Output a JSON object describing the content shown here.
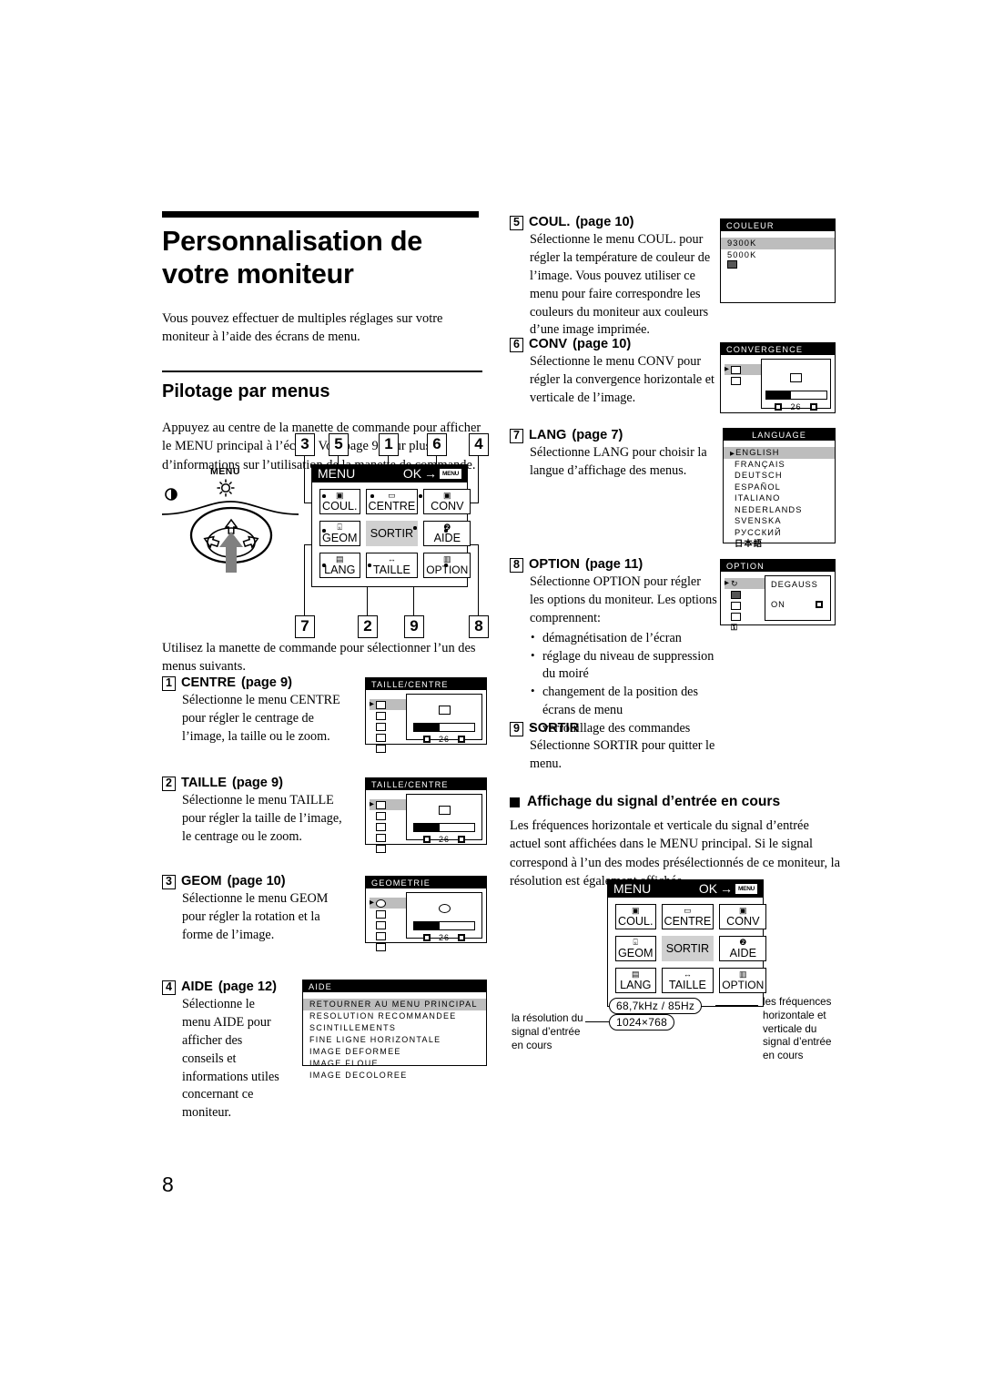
{
  "page": {
    "number": "8"
  },
  "heading": {
    "title": "Personnalisation de votre moniteur",
    "intro": "Vous pouvez effectuer de multiples réglages sur votre moniteur à l’aide des écrans de menu.",
    "subtitle": "Pilotage par menus",
    "body": "Appuyez au centre de la manette de commande pour afficher le MENU principal à l’écran. Voir page 9 pour plus d’informations sur l’utilisation de la manette de commande.",
    "after_diagram": "Utilisez la manette de commande pour sélectionner l’un des menus suivants."
  },
  "joystick": {
    "menu_label": "MENU",
    "brightness_icon": "sun-icon",
    "contrast_icon": "contrast-icon"
  },
  "main_menu": {
    "title": "MENU",
    "ok_label": "OK",
    "ok_arrow": "→",
    "ok_chip": "MENU",
    "cells": [
      {
        "label": "COUL.",
        "glyph": "color-icon"
      },
      {
        "label": "CENTRE",
        "glyph": "centre-icon"
      },
      {
        "label": "CONV",
        "glyph": "conv-icon"
      },
      {
        "label": "GEOM",
        "glyph": "geom-icon"
      },
      {
        "label": "SORTIR",
        "glyph": ""
      },
      {
        "label": "AIDE",
        "glyph": "question-icon"
      },
      {
        "label": "LANG",
        "glyph": "lang-icon"
      },
      {
        "label": "TAILLE",
        "glyph": "size-icon"
      },
      {
        "label": "OPTION",
        "glyph": "option-icon"
      }
    ],
    "callout_numbers_top": [
      "3",
      "5",
      "1",
      "6",
      "4"
    ],
    "callout_numbers_bottom": [
      "7",
      "2",
      "9",
      "8"
    ]
  },
  "items_left": [
    {
      "num": "1",
      "name": "CENTRE",
      "page": "(page 9)",
      "text": "Sélectionne le menu CENTRE pour régler le centrage de l’image, la taille ou le zoom.",
      "osd": {
        "title": "TAILLE/CENTRE",
        "value": "26",
        "fill_pct": 42
      }
    },
    {
      "num": "2",
      "name": "TAILLE",
      "page": "(page 9)",
      "text": "Sélectionne le menu TAILLE pour régler la taille de l’image, le centrage ou le zoom.",
      "osd": {
        "title": "TAILLE/CENTRE",
        "value": "26",
        "fill_pct": 42
      }
    },
    {
      "num": "3",
      "name": "GEOM",
      "page": "(page 10)",
      "text": "Sélectionne le menu GEOM pour régler la rotation et la forme de l’image.",
      "osd": {
        "title": "GEOMETRIE",
        "value": "26",
        "fill_pct": 42
      }
    },
    {
      "num": "4",
      "name": "AIDE",
      "page": "(page 12)",
      "text": "Sélectionne le menu AIDE pour afficher des conseils et informations utiles concernant ce moniteur.",
      "osd": {
        "title": "AIDE",
        "rows": [
          "RETOURNER AU MENU PRINCIPAL",
          "RESOLUTION RECOMMANDEE",
          "SCINTILLEMENTS",
          "FINE LIGNE HORIZONTALE",
          "IMAGE DEFORMEE",
          "IMAGE FLOUE",
          "IMAGE DECOLOREE"
        ],
        "selected_index": 0
      }
    }
  ],
  "items_right": [
    {
      "num": "5",
      "name": "COUL.",
      "page": "(page 10)",
      "text": "Sélectionne le menu COUL. pour régler la température de couleur de l’image. Vous pouvez utiliser ce menu pour faire correspondre les couleurs du moniteur aux couleurs d’une image imprimée.",
      "osd": {
        "title": "COULEUR",
        "rows": [
          "9300K",
          "5000K"
        ],
        "selected_index": 0
      }
    },
    {
      "num": "6",
      "name": "CONV",
      "page": "(page 10)",
      "text": "Sélectionne le menu CONV pour régler la convergence horizontale et verticale de l’image.",
      "osd": {
        "title": "CONVERGENCE",
        "value": "26",
        "fill_pct": 42
      }
    },
    {
      "num": "7",
      "name": "LANG",
      "page": "(page 7)",
      "text": "Sélectionne LANG pour choisir la langue d’affichage des menus.",
      "osd": {
        "title": "LANGUAGE",
        "rows": [
          "ENGLISH",
          "FRANÇAIS",
          "DEUTSCH",
          "ESPAÑOL",
          "ITALIANO",
          "NEDERLANDS",
          "SVENSKA",
          "РУССКИЙ",
          "日本語"
        ],
        "selected_index": 0
      }
    },
    {
      "num": "8",
      "name": "OPTION",
      "page": "(page 11)",
      "text": "Sélectionne OPTION pour régler les options du moniteur. Les options comprennent:",
      "bullets": [
        "démagnétisation de l’écran",
        "réglage du niveau de suppression du moiré",
        "changement de la position des écrans de menu",
        "verrouillage des commandes"
      ],
      "osd": {
        "title": "OPTION",
        "label": "DEGAUSS",
        "value": "ON"
      }
    },
    {
      "num": "9",
      "name": "SORTIR",
      "page": "",
      "text": "Sélectionne SORTIR pour quitter le menu."
    }
  ],
  "signal_section": {
    "heading": "Affichage du signal d’entrée en cours",
    "text": "Les fréquences horizontale et verticale du signal d’entrée actuel sont affichées dans le MENU principal. Si le signal correspond à l’un des modes présélectionnés de ce moniteur, la résolution est également affichée.",
    "freq_pill": "68,7kHz /  85Hz",
    "res_pill": "1024×768",
    "caption_left": "la résolution du signal d’entrée en cours",
    "caption_right": "les fréquences horizontale et verticale du signal d’entrée en cours"
  }
}
